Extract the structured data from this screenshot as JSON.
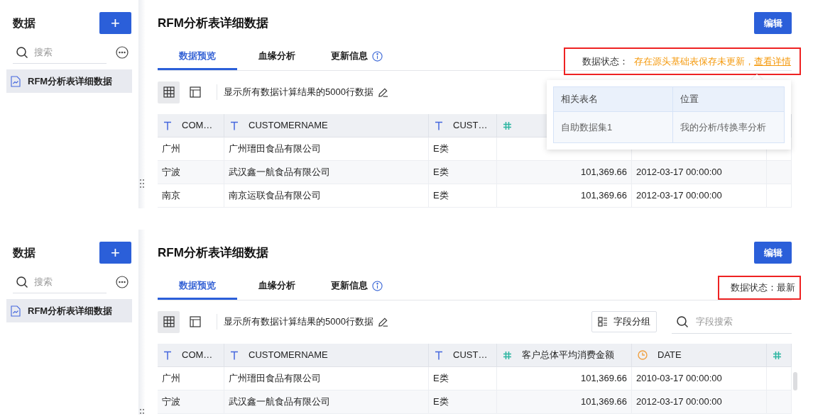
{
  "panels": [
    {
      "sidebar": {
        "title": "数据",
        "add_button": "+",
        "search": {
          "placeholder": "搜索"
        },
        "items": [
          {
            "label": "RFM分析表详细数据",
            "selected": true
          }
        ]
      },
      "title": "RFM分析表详细数据",
      "edit_button": "编辑",
      "tabs": [
        {
          "label": "数据预览",
          "selected": true,
          "info": false
        },
        {
          "label": "血缘分析",
          "selected": false,
          "info": false
        },
        {
          "label": "更新信息",
          "selected": false,
          "info": true
        }
      ],
      "status": {
        "kind": "warning",
        "label": "数据状态：",
        "text": "存在源头基础表保存未更新，",
        "link": "查看详情"
      },
      "toolbar": {
        "views": [
          {
            "kind": "grid",
            "selected": true
          },
          {
            "kind": "layout",
            "selected": false
          }
        ],
        "summary": "显示所有数据计算结果的5000行数据"
      },
      "table": {
        "columns": [
          {
            "kind": "text",
            "label": "COM…"
          },
          {
            "kind": "text",
            "label": "CUSTOMERNAME"
          },
          {
            "kind": "text",
            "label": "CUST…"
          },
          {
            "kind": "number"
          }
        ],
        "rows": [
          [
            "广州",
            "广州瑨田食品有限公司",
            "E类"
          ],
          [
            "宁波",
            "武汉鑫一航食品有限公司",
            "E类",
            "101,369.66",
            "2012-03-17 00:00:00"
          ],
          [
            "南京",
            "南京运联食品有限公司",
            "E类",
            "101,369.66",
            "2012-03-17 00:00:00"
          ]
        ]
      },
      "popover": {
        "columns": [
          "相关表名",
          "位置"
        ],
        "rows": [
          [
            "自助数据集1",
            "我的分析/转换率分析"
          ]
        ]
      }
    },
    {
      "sidebar": {
        "title": "数据",
        "add_button": "+",
        "search": {
          "placeholder": "搜索"
        },
        "items": [
          {
            "label": "RFM分析表详细数据",
            "selected": true
          }
        ]
      },
      "title": "RFM分析表详细数据",
      "edit_button": "编辑",
      "tabs": [
        {
          "label": "数据预览",
          "selected": true,
          "info": false
        },
        {
          "label": "血缘分析",
          "selected": false,
          "info": false
        },
        {
          "label": "更新信息",
          "selected": false,
          "info": true
        }
      ],
      "status": {
        "kind": "latest",
        "label": "数据状态：",
        "text": "最新"
      },
      "toolbar": {
        "views": [
          {
            "kind": "grid",
            "selected": true
          },
          {
            "kind": "layout",
            "selected": false
          }
        ],
        "summary": "显示所有数据计算结果的5000行数据",
        "group_button": "字段分组",
        "field_search": {
          "placeholder": "字段搜索"
        }
      },
      "table": {
        "columns": [
          {
            "kind": "text",
            "label": "COM…"
          },
          {
            "kind": "text",
            "label": "CUSTOMERNAME"
          },
          {
            "kind": "text",
            "label": "CUST…"
          },
          {
            "kind": "number",
            "label": "客户总体平均消费金额"
          },
          {
            "kind": "date",
            "label": "DATE"
          },
          {
            "kind": "number"
          }
        ],
        "rows": [
          [
            "广州",
            "广州瑨田食品有限公司",
            "E类",
            "101,369.66",
            "2010-03-17 00:00:00"
          ],
          [
            "宁波",
            "武汉鑫一航食品有限公司",
            "E类",
            "101,369.66",
            "2012-03-17 00:00:00"
          ]
        ]
      }
    }
  ]
}
